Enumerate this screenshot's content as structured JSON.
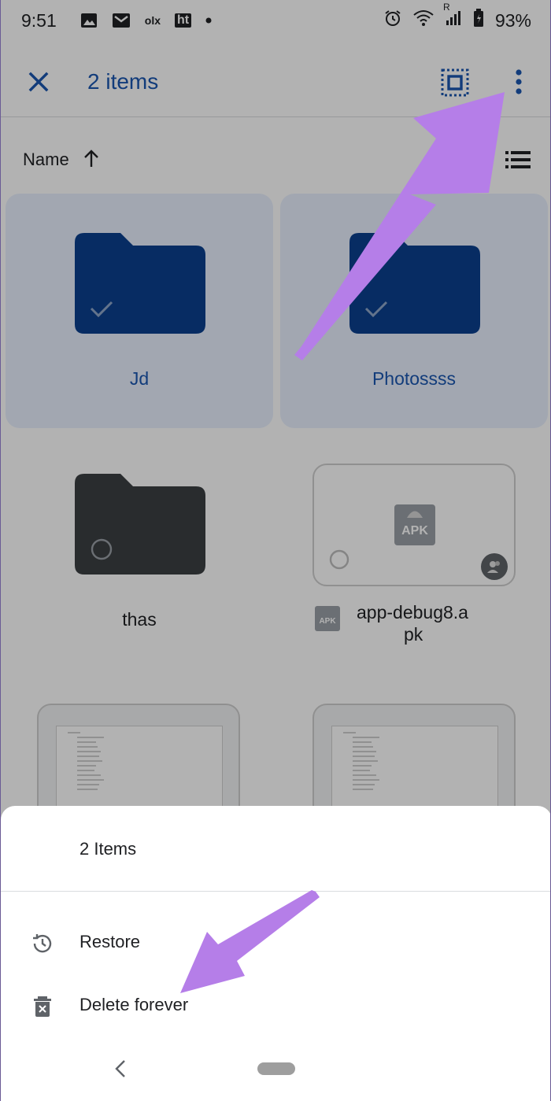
{
  "status_bar": {
    "time": "9:51",
    "battery": "93%",
    "carrier_tag": "ht",
    "olx_tag": "olx",
    "roaming_tag": "R"
  },
  "app_bar": {
    "title": "2 items",
    "close_icon": "close-icon",
    "select_all_icon": "select-all-icon",
    "more_icon": "more-vert-icon",
    "accent_color": "#1a56b0"
  },
  "sort": {
    "label": "Name",
    "direction_icon": "arrow-up-icon",
    "view_icon": "list-view-icon"
  },
  "grid": {
    "items": [
      {
        "name": "Jd",
        "type": "folder",
        "selected": true
      },
      {
        "name": "Photossss",
        "type": "folder",
        "selected": true
      },
      {
        "name": "thas",
        "type": "folder",
        "selected": false
      },
      {
        "name_line1": "app-debug8.a",
        "name_line2": "pk",
        "type": "apk",
        "thumb_label": "APK",
        "file_label": "APK",
        "selected": false
      }
    ]
  },
  "sheet": {
    "title": "2 Items",
    "items": [
      {
        "label": "Restore",
        "icon": "restore-history-icon"
      },
      {
        "label": "Delete forever",
        "icon": "delete-forever-icon"
      }
    ]
  },
  "colors": {
    "selected_card": "#e8f0fe",
    "folder_selected": "#0b3f8f",
    "folder_plain": "#3c4043",
    "annotation_arrow": "#b57ee8"
  }
}
